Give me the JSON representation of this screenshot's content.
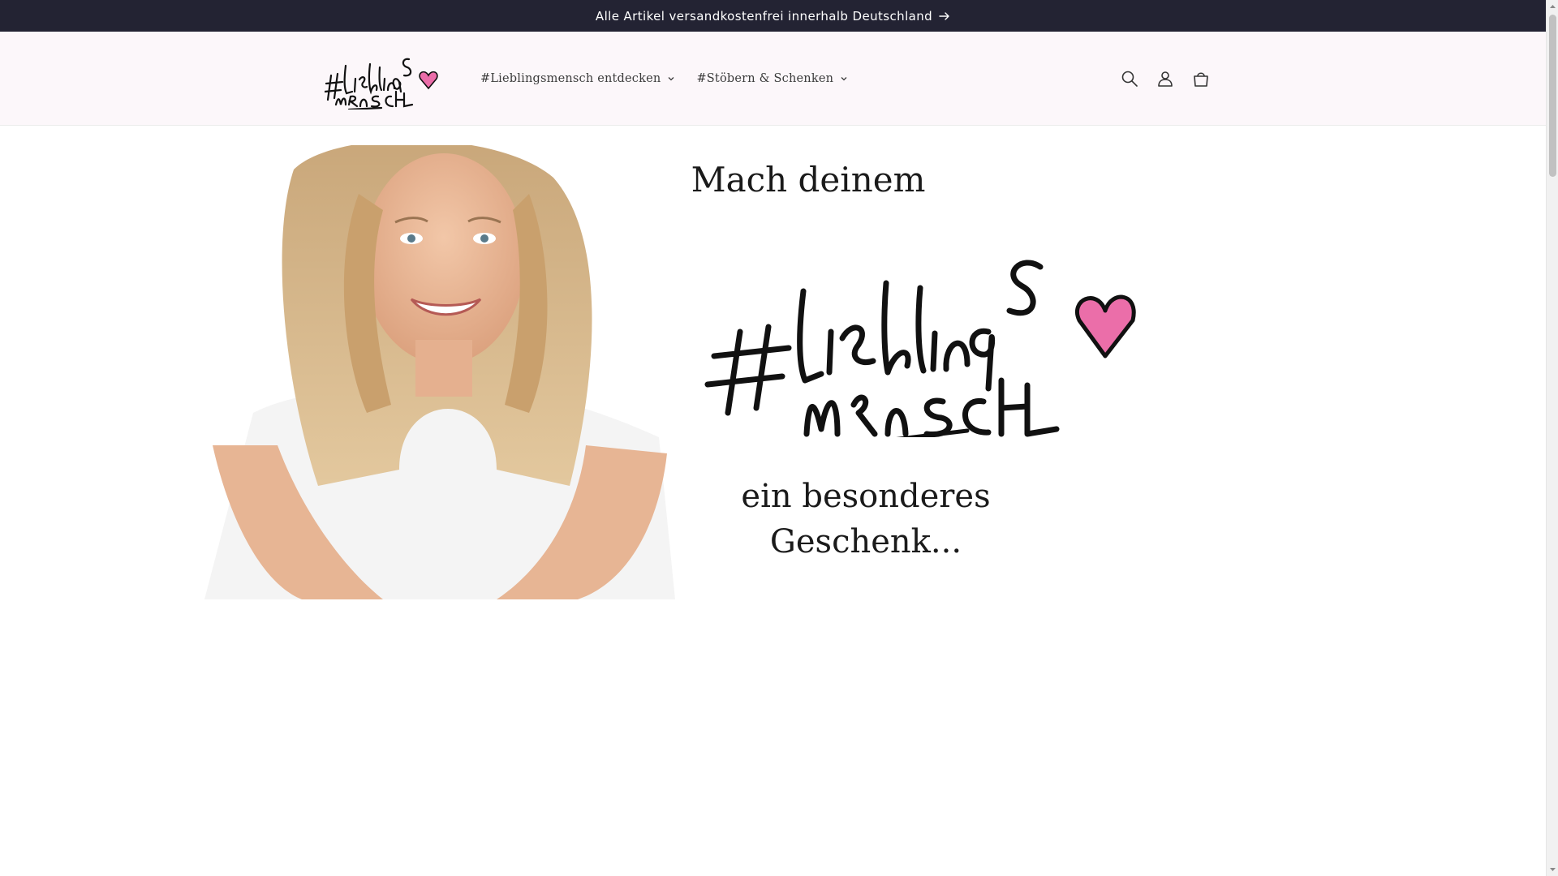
{
  "announcement": {
    "text": "Alle Artikel versandkostenfrei innerhalb Deutschland",
    "icon": "arrow-right-icon"
  },
  "header": {
    "logo_text": "#LieblingsMensch",
    "nav": [
      {
        "label": "#Lieblingsmensch entdecken",
        "icon": "chevron-down-icon"
      },
      {
        "label": "#Stöbern & Schenken",
        "icon": "chevron-down-icon"
      }
    ],
    "icons": [
      "search-icon",
      "account-icon",
      "cart-icon"
    ]
  },
  "hero": {
    "line_top": "Mach deinem",
    "brand": "#LieblingsMensch",
    "line_bottom_1": "ein besonderes",
    "line_bottom_2": "Geschenk..."
  },
  "colors": {
    "announcement_bg": "#232333",
    "header_bg": "#fcf7fa",
    "heart_pink": "#e8559a"
  }
}
